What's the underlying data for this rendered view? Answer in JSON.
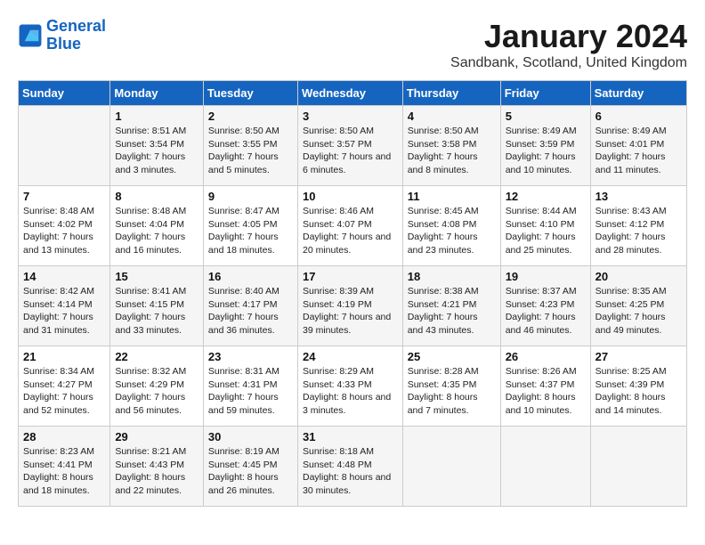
{
  "logo": {
    "line1": "General",
    "line2": "Blue"
  },
  "title": "January 2024",
  "subtitle": "Sandbank, Scotland, United Kingdom",
  "headers": [
    "Sunday",
    "Monday",
    "Tuesday",
    "Wednesday",
    "Thursday",
    "Friday",
    "Saturday"
  ],
  "weeks": [
    [
      {
        "day": "",
        "sunrise": "",
        "sunset": "",
        "daylight": ""
      },
      {
        "day": "1",
        "sunrise": "8:51 AM",
        "sunset": "3:54 PM",
        "daylight": "7 hours and 3 minutes."
      },
      {
        "day": "2",
        "sunrise": "8:50 AM",
        "sunset": "3:55 PM",
        "daylight": "7 hours and 5 minutes."
      },
      {
        "day": "3",
        "sunrise": "8:50 AM",
        "sunset": "3:57 PM",
        "daylight": "7 hours and 6 minutes."
      },
      {
        "day": "4",
        "sunrise": "8:50 AM",
        "sunset": "3:58 PM",
        "daylight": "7 hours and 8 minutes."
      },
      {
        "day": "5",
        "sunrise": "8:49 AM",
        "sunset": "3:59 PM",
        "daylight": "7 hours and 10 minutes."
      },
      {
        "day": "6",
        "sunrise": "8:49 AM",
        "sunset": "4:01 PM",
        "daylight": "7 hours and 11 minutes."
      }
    ],
    [
      {
        "day": "7",
        "sunrise": "8:48 AM",
        "sunset": "4:02 PM",
        "daylight": "7 hours and 13 minutes."
      },
      {
        "day": "8",
        "sunrise": "8:48 AM",
        "sunset": "4:04 PM",
        "daylight": "7 hours and 16 minutes."
      },
      {
        "day": "9",
        "sunrise": "8:47 AM",
        "sunset": "4:05 PM",
        "daylight": "7 hours and 18 minutes."
      },
      {
        "day": "10",
        "sunrise": "8:46 AM",
        "sunset": "4:07 PM",
        "daylight": "7 hours and 20 minutes."
      },
      {
        "day": "11",
        "sunrise": "8:45 AM",
        "sunset": "4:08 PM",
        "daylight": "7 hours and 23 minutes."
      },
      {
        "day": "12",
        "sunrise": "8:44 AM",
        "sunset": "4:10 PM",
        "daylight": "7 hours and 25 minutes."
      },
      {
        "day": "13",
        "sunrise": "8:43 AM",
        "sunset": "4:12 PM",
        "daylight": "7 hours and 28 minutes."
      }
    ],
    [
      {
        "day": "14",
        "sunrise": "8:42 AM",
        "sunset": "4:14 PM",
        "daylight": "7 hours and 31 minutes."
      },
      {
        "day": "15",
        "sunrise": "8:41 AM",
        "sunset": "4:15 PM",
        "daylight": "7 hours and 33 minutes."
      },
      {
        "day": "16",
        "sunrise": "8:40 AM",
        "sunset": "4:17 PM",
        "daylight": "7 hours and 36 minutes."
      },
      {
        "day": "17",
        "sunrise": "8:39 AM",
        "sunset": "4:19 PM",
        "daylight": "7 hours and 39 minutes."
      },
      {
        "day": "18",
        "sunrise": "8:38 AM",
        "sunset": "4:21 PM",
        "daylight": "7 hours and 43 minutes."
      },
      {
        "day": "19",
        "sunrise": "8:37 AM",
        "sunset": "4:23 PM",
        "daylight": "7 hours and 46 minutes."
      },
      {
        "day": "20",
        "sunrise": "8:35 AM",
        "sunset": "4:25 PM",
        "daylight": "7 hours and 49 minutes."
      }
    ],
    [
      {
        "day": "21",
        "sunrise": "8:34 AM",
        "sunset": "4:27 PM",
        "daylight": "7 hours and 52 minutes."
      },
      {
        "day": "22",
        "sunrise": "8:32 AM",
        "sunset": "4:29 PM",
        "daylight": "7 hours and 56 minutes."
      },
      {
        "day": "23",
        "sunrise": "8:31 AM",
        "sunset": "4:31 PM",
        "daylight": "7 hours and 59 minutes."
      },
      {
        "day": "24",
        "sunrise": "8:29 AM",
        "sunset": "4:33 PM",
        "daylight": "8 hours and 3 minutes."
      },
      {
        "day": "25",
        "sunrise": "8:28 AM",
        "sunset": "4:35 PM",
        "daylight": "8 hours and 7 minutes."
      },
      {
        "day": "26",
        "sunrise": "8:26 AM",
        "sunset": "4:37 PM",
        "daylight": "8 hours and 10 minutes."
      },
      {
        "day": "27",
        "sunrise": "8:25 AM",
        "sunset": "4:39 PM",
        "daylight": "8 hours and 14 minutes."
      }
    ],
    [
      {
        "day": "28",
        "sunrise": "8:23 AM",
        "sunset": "4:41 PM",
        "daylight": "8 hours and 18 minutes."
      },
      {
        "day": "29",
        "sunrise": "8:21 AM",
        "sunset": "4:43 PM",
        "daylight": "8 hours and 22 minutes."
      },
      {
        "day": "30",
        "sunrise": "8:19 AM",
        "sunset": "4:45 PM",
        "daylight": "8 hours and 26 minutes."
      },
      {
        "day": "31",
        "sunrise": "8:18 AM",
        "sunset": "4:48 PM",
        "daylight": "8 hours and 30 minutes."
      },
      {
        "day": "",
        "sunrise": "",
        "sunset": "",
        "daylight": ""
      },
      {
        "day": "",
        "sunrise": "",
        "sunset": "",
        "daylight": ""
      },
      {
        "day": "",
        "sunrise": "",
        "sunset": "",
        "daylight": ""
      }
    ]
  ]
}
